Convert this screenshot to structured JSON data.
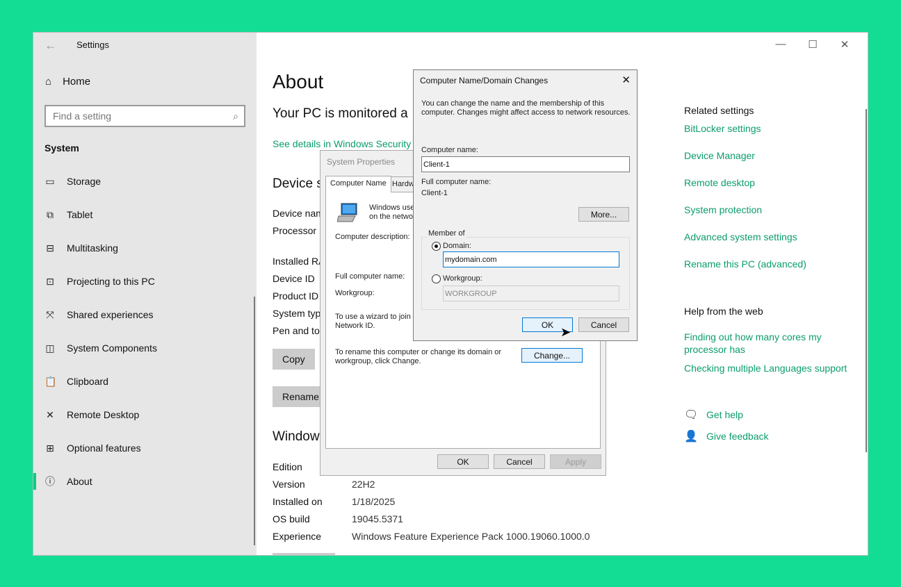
{
  "app": {
    "title": "Settings",
    "back_glyph": "←"
  },
  "sidebar": {
    "home_label": "Home",
    "search_placeholder": "Find a setting",
    "section": "System",
    "items": [
      {
        "label": "Storage",
        "icon": "storage-icon"
      },
      {
        "label": "Tablet",
        "icon": "tablet-icon"
      },
      {
        "label": "Multitasking",
        "icon": "multitasking-icon"
      },
      {
        "label": "Projecting to this PC",
        "icon": "projecting-icon"
      },
      {
        "label": "Shared experiences",
        "icon": "shared-experiences-icon"
      },
      {
        "label": "System Components",
        "icon": "system-components-icon"
      },
      {
        "label": "Clipboard",
        "icon": "clipboard-icon"
      },
      {
        "label": "Remote Desktop",
        "icon": "remote-desktop-icon"
      },
      {
        "label": "Optional features",
        "icon": "optional-features-icon"
      },
      {
        "label": "About",
        "icon": "info-icon",
        "active": true
      }
    ]
  },
  "main": {
    "title": "About",
    "monitor_text": "Your PC is monitored a",
    "security_link": "See details in Windows Security",
    "device_heading": "Device s",
    "specs": [
      "Device nam",
      "Processor",
      "Installed RA",
      "Device ID",
      "Product ID",
      "System typ",
      "Pen and tou"
    ],
    "copy_button": "Copy",
    "rename_button": "Rename",
    "windows_heading": "Window",
    "windows_specs": [
      {
        "label": "Edition",
        "value": ""
      },
      {
        "label": "Version",
        "value": "22H2"
      },
      {
        "label": "Installed on",
        "value": "1/18/2025"
      },
      {
        "label": "OS build",
        "value": "19045.5371"
      },
      {
        "label": "Experience",
        "value": "Windows Feature Experience Pack 1000.19060.1000.0"
      }
    ]
  },
  "related": {
    "title": "Related settings",
    "links": [
      "BitLocker settings",
      "Device Manager",
      "Remote desktop",
      "System protection",
      "Advanced system settings",
      "Rename this PC (advanced)"
    ]
  },
  "help": {
    "title": "Help from the web",
    "links": [
      "Finding out how many cores my processor has",
      "Checking multiple Languages support"
    ],
    "get_help": "Get help",
    "give_feedback": "Give feedback"
  },
  "system_properties": {
    "title": "System Properties",
    "tabs": [
      "Computer Name",
      "Hardw"
    ],
    "windows_uses": "Windows use\non the networ",
    "computer_description_label": "Computer description:",
    "full_computer_name_label": "Full computer name:",
    "workgroup_label": "Workgroup:",
    "wizard_text": "To use a wizard to join a\nNetwork ID.",
    "rename_text": "To rename this computer or change its domain or\nworkgroup, click Change.",
    "change_button": "Change...",
    "ok_button": "OK",
    "cancel_button": "Cancel",
    "apply_button": "Apply"
  },
  "domain_dialog": {
    "title": "Computer Name/Domain Changes",
    "close_glyph": "✕",
    "intro": "You can change the name and the membership of this\ncomputer. Changes might affect access to network resources.",
    "computer_name_label": "Computer name:",
    "computer_name_value": "Client-1",
    "full_name_label": "Full computer name:",
    "full_name_value": "Client-1",
    "more_button": "More...",
    "member_of_label": "Member of",
    "domain_label": "Domain:",
    "domain_value": "mydomain.com",
    "workgroup_label": "Workgroup:",
    "workgroup_value": "WORKGROUP",
    "ok_button": "OK",
    "cancel_button": "Cancel"
  },
  "colors": {
    "accent": "#0a9d6a",
    "desktop": "#13dd95"
  }
}
